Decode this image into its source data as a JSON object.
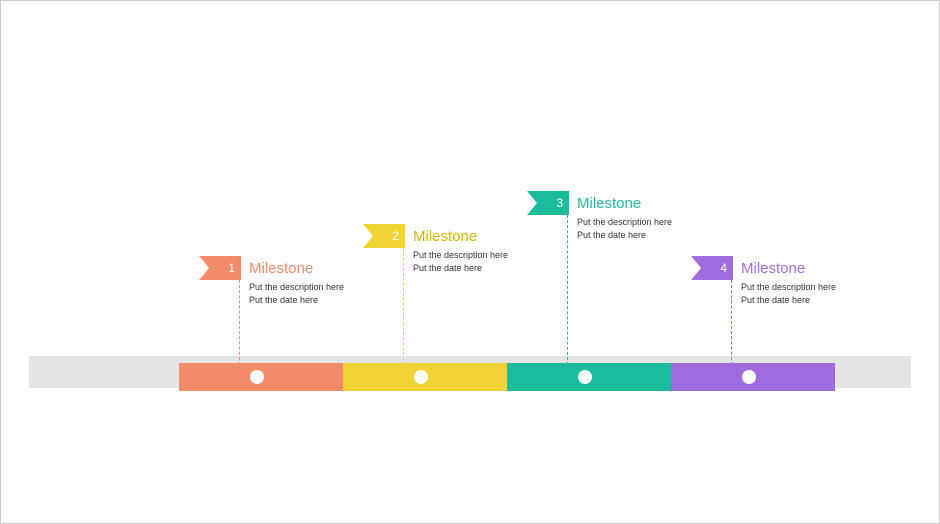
{
  "milestones": [
    {
      "number": "1",
      "title": "Milestone",
      "description": "Put the description here",
      "date": "Put the date here",
      "color": "#f28b6b",
      "titleColor": "#f28b6b",
      "segLeft": 178,
      "segWidth": 164,
      "dotX": 256,
      "flagLeft": 198,
      "flagTop": 255,
      "labelLeft": 248,
      "labelTop": 259,
      "connTop": 279,
      "connHeight": 90
    },
    {
      "number": "2",
      "title": "Milestone",
      "description": "Put the description here",
      "date": "Put the date here",
      "color": "#f2d335",
      "titleColor": "#d4b800",
      "segLeft": 342,
      "segWidth": 164,
      "dotX": 420,
      "flagLeft": 362,
      "flagTop": 223,
      "labelLeft": 412,
      "labelTop": 227,
      "connTop": 247,
      "connHeight": 122
    },
    {
      "number": "3",
      "title": "Milestone",
      "description": "Put the description here",
      "date": "Put the date here",
      "color": "#1abc9c",
      "titleColor": "#1abc9c",
      "segLeft": 506,
      "segWidth": 164,
      "dotX": 584,
      "flagLeft": 526,
      "flagTop": 190,
      "labelLeft": 576,
      "labelTop": 194,
      "connTop": 214,
      "connHeight": 155
    },
    {
      "number": "4",
      "title": "Milestone",
      "description": "Put the description here",
      "date": "Put the date here",
      "color": "#a16be0",
      "titleColor": "#a16be0",
      "segLeft": 670,
      "segWidth": 164,
      "dotX": 748,
      "flagLeft": 690,
      "flagTop": 255,
      "labelLeft": 740,
      "labelTop": 259,
      "connTop": 279,
      "connHeight": 90
    }
  ]
}
